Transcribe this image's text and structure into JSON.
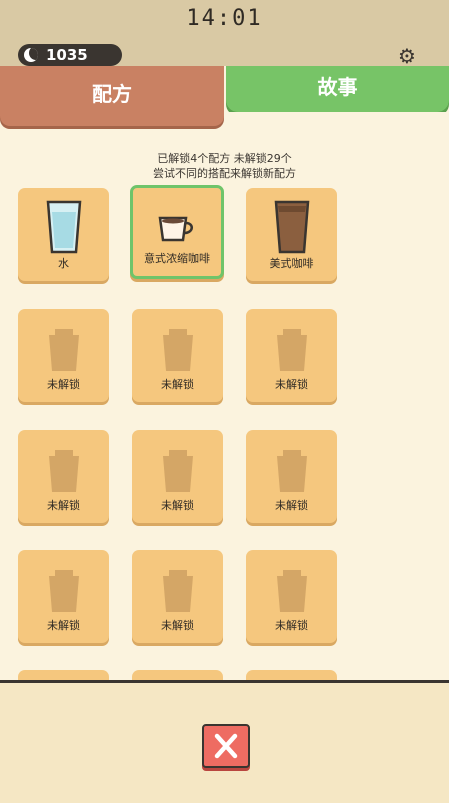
{
  "status_bar": {
    "clock": "14:01"
  },
  "currency": {
    "value": "1035",
    "icon": "moon-icon"
  },
  "settings": {
    "icon": "gear-icon"
  },
  "tabs": [
    {
      "label": "配方",
      "active": true,
      "color": "#c98163"
    },
    {
      "label": "故事",
      "active": false,
      "color": "#77c467"
    }
  ],
  "info": {
    "unlocked_line": "已解锁4个配方 未解锁29个",
    "hint_line": "尝试不同的搭配来解锁新配方"
  },
  "recipes": [
    {
      "name": "水",
      "unlocked": true,
      "icon": "water-glass-icon",
      "selected": false
    },
    {
      "name": "意式浓缩咖啡",
      "unlocked": true,
      "icon": "espresso-cup-icon",
      "selected": true
    },
    {
      "name": "美式咖啡",
      "unlocked": true,
      "icon": "americano-glass-icon",
      "selected": false
    },
    {
      "name": "未解锁",
      "unlocked": false,
      "icon": "locked-cup-icon"
    },
    {
      "name": "未解锁",
      "unlocked": false,
      "icon": "locked-cup-icon"
    },
    {
      "name": "未解锁",
      "unlocked": false,
      "icon": "locked-cup-icon"
    },
    {
      "name": "未解锁",
      "unlocked": false,
      "icon": "locked-cup-icon"
    },
    {
      "name": "未解锁",
      "unlocked": false,
      "icon": "locked-cup-icon"
    },
    {
      "name": "未解锁",
      "unlocked": false,
      "icon": "locked-cup-icon"
    },
    {
      "name": "未解锁",
      "unlocked": false,
      "icon": "locked-cup-icon"
    },
    {
      "name": "未解锁",
      "unlocked": false,
      "icon": "locked-cup-icon"
    },
    {
      "name": "未解锁",
      "unlocked": false,
      "icon": "locked-cup-icon"
    }
  ],
  "close_button": {
    "icon": "close-icon",
    "color": "#ee6c62"
  },
  "colors": {
    "card": "#f5c77e",
    "selected_border": "#6fc46a",
    "background": "#fbf3de"
  }
}
